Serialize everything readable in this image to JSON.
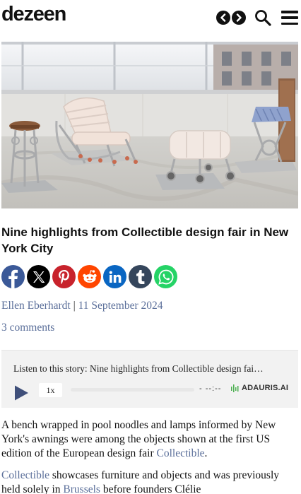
{
  "site": {
    "logo": "dezeen"
  },
  "nav": {
    "prev_icon": "chevron-left-icon",
    "next_icon": "chevron-right-icon",
    "search_icon": "search-icon",
    "menu_icon": "hamburger-menu-icon"
  },
  "article": {
    "headline": "Nine highlights from Collectible design fair in New York City",
    "author": "Ellen Eberhardt",
    "separator": "|",
    "date": "11 September 2024",
    "comments": "3 comments"
  },
  "share": [
    {
      "name": "facebook-icon",
      "color": "#3b5998"
    },
    {
      "name": "x-icon",
      "color": "#000000"
    },
    {
      "name": "pinterest-icon",
      "color": "#c8232c"
    },
    {
      "name": "reddit-icon",
      "color": "#ff4500"
    },
    {
      "name": "linkedin-icon",
      "color": "#0a66c2"
    },
    {
      "name": "tumblr-icon",
      "color": "#35465c"
    },
    {
      "name": "whatsapp-icon",
      "color": "#25d366"
    }
  ],
  "audio": {
    "title": "Listen to this story: Nine highlights from Collectible design fai…",
    "speed": "1x",
    "time": "- --:--",
    "brand": "ADAURIS.AI",
    "progress": 0
  },
  "body": {
    "p1_text": "A bench wrapped in pool noodles and lamps informed by New York's awnings were among the objects shown at the first US edition of the European design fair ",
    "p1_link": "Collectible",
    "p1_end": ".",
    "p2_link1": "Collectible",
    "p2_text1": " showcases furniture and objects and was previously held solely in ",
    "p2_link2": "Brussels",
    "p2_text2": " before founders Clélie"
  }
}
